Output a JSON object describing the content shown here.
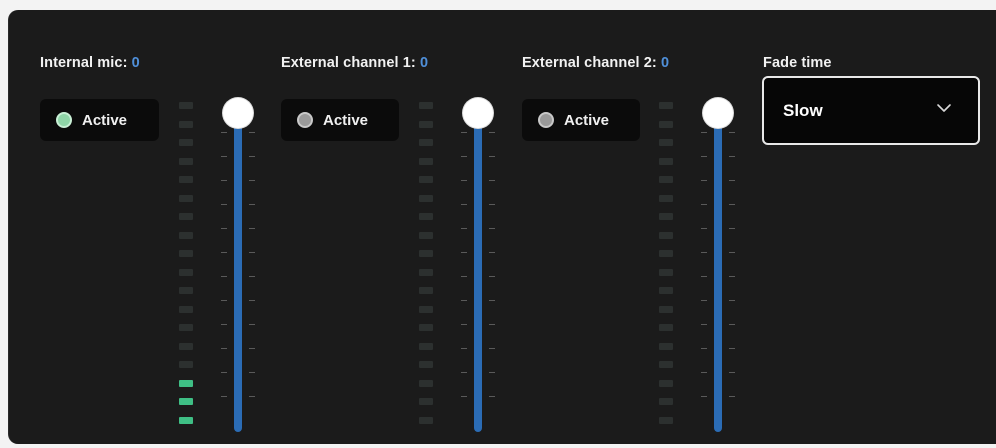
{
  "channels": [
    {
      "label": "Internal mic:",
      "value": "0",
      "toggle_label": "Active",
      "toggle_on": true,
      "meter_level": 0.18,
      "slider_level": 1.0
    },
    {
      "label": "External channel 1:",
      "value": "0",
      "toggle_label": "Active",
      "toggle_on": false,
      "meter_level": 0.0,
      "slider_level": 1.0
    },
    {
      "label": "External channel 2:",
      "value": "0",
      "toggle_label": "Active",
      "toggle_on": false,
      "meter_level": 0.0,
      "slider_level": 1.0
    }
  ],
  "fade": {
    "label": "Fade time",
    "selected": "Slow",
    "icon": "chevron-down-icon"
  },
  "colors": {
    "panel_bg": "#1b1b1b",
    "value_blue": "#4f8fd9",
    "active_green": "#8fd6a8",
    "inactive_gray": "#9a9a9a",
    "meter_lit": "#3fbf85",
    "slider_track": "#2b6cb5"
  }
}
